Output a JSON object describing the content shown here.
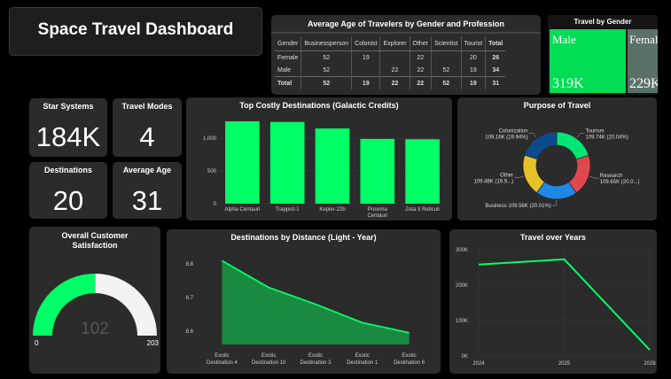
{
  "title": "Space Travel Dashboard",
  "colors": {
    "accent": "#00ff66",
    "female_tile": "#5a7168",
    "card": "#2b2b2b",
    "gauge_remaining": "#f2f2f2"
  },
  "age_table": {
    "title": "Average Age of Travelers by Gender and Profession",
    "headers": [
      "Gender",
      "Businessperson",
      "Colonist",
      "Explorer",
      "Other",
      "Scientist",
      "Tourist",
      "Total"
    ],
    "rows": [
      [
        "Female",
        "52",
        "19",
        "",
        "22",
        "",
        "20",
        "26"
      ],
      [
        "Male",
        "52",
        "",
        "22",
        "22",
        "52",
        "19",
        "34"
      ]
    ],
    "total": [
      "Total",
      "52",
      "19",
      "22",
      "22",
      "52",
      "19",
      "31"
    ]
  },
  "gender": {
    "title": "Travel by Gender",
    "male_label": "Male",
    "male_value": "319K",
    "female_label": "Female",
    "female_value": "229K"
  },
  "kpis": {
    "star_systems": {
      "label": "Star Systems",
      "value": "184K"
    },
    "travel_modes": {
      "label": "Travel Modes",
      "value": "4"
    },
    "destinations": {
      "label": "Destinations",
      "value": "20"
    },
    "average_age": {
      "label": "Average Age",
      "value": "31"
    }
  },
  "costly_chart": {
    "title": "Top Costly Destinations (Galactic Credits)",
    "chart_data": {
      "type": "bar",
      "categories": [
        "Alpha Centauri",
        "Trappist-1",
        "Kepler-22b",
        "Proxima Centauri",
        "Zeta II Reticuli"
      ],
      "category_lines": [
        [
          "Alpha Centauri"
        ],
        [
          "Trappist-1"
        ],
        [
          "Kepler-22b"
        ],
        [
          "Proxima",
          "Centauri"
        ],
        [
          "Zeta II Reticuli"
        ]
      ],
      "values": [
        1260,
        1250,
        1150,
        990,
        985
      ],
      "ylim": [
        0,
        1300
      ],
      "yticks": [
        0,
        500,
        1000
      ],
      "ytick_labels": [
        "0",
        "500",
        "1,000"
      ],
      "grid": true
    }
  },
  "purpose_chart": {
    "title": "Purpose of Travel",
    "chart_data": {
      "type": "pie",
      "donut": true,
      "slices": [
        {
          "label": "Tourism",
          "value_text": "109.74K (20.04%)",
          "value": 109.74,
          "color": "#00e676"
        },
        {
          "label": "Research",
          "value_text": "109.65K (20.0...)",
          "value": 109.65,
          "color": "#e0474c"
        },
        {
          "label": "Business",
          "value_text": "109.56K (20.01%)",
          "value": 109.56,
          "color": "#1e88e5"
        },
        {
          "label": "Other",
          "value_text": "109.46K (19.9...)",
          "value": 109.46,
          "color": "#e6c229"
        },
        {
          "label": "Colonization",
          "value_text": "109.16K (19.94%)",
          "value": 109.16,
          "color": "#0d4a8c"
        }
      ]
    }
  },
  "satisfaction": {
    "title_line1": "Overall Customer",
    "title_line2": "Satisfaction",
    "value": 102,
    "min": 0,
    "max": 203,
    "value_text": "102",
    "min_text": "0",
    "max_text": "203"
  },
  "distance_chart": {
    "title": "Destinations by Distance (Light - Year)",
    "chart_data": {
      "type": "area",
      "categories": [
        "Exotic Destination 4",
        "Exotic Destination 10",
        "Exotic Destination 3",
        "Exotic Destination 1",
        "Exotic Destination 6"
      ],
      "category_lines": [
        [
          "Exotic",
          "Destination 4"
        ],
        [
          "Exotic",
          "Destination 10"
        ],
        [
          "Exotic",
          "Destination 3"
        ],
        [
          "Exotic",
          "Destination 1"
        ],
        [
          "Exotic",
          "Destination 6"
        ]
      ],
      "values": [
        8.81,
        8.73,
        8.68,
        8.625,
        8.595
      ],
      "ylim": [
        8.56,
        8.84
      ],
      "yticks": [
        8.6,
        8.7,
        8.8
      ],
      "ytick_labels": [
        "8.6",
        "8.7",
        "8.8"
      ]
    }
  },
  "years_chart": {
    "title": "Travel over Years",
    "chart_data": {
      "type": "line",
      "x": [
        "2024",
        "2025",
        "2026"
      ],
      "values": [
        258000,
        273000,
        17000
      ],
      "ylim": [
        0,
        300000
      ],
      "yticks": [
        0,
        100000,
        200000,
        300000
      ],
      "ytick_labels": [
        "0K",
        "100K",
        "200K",
        "300K"
      ],
      "grid": true
    }
  }
}
